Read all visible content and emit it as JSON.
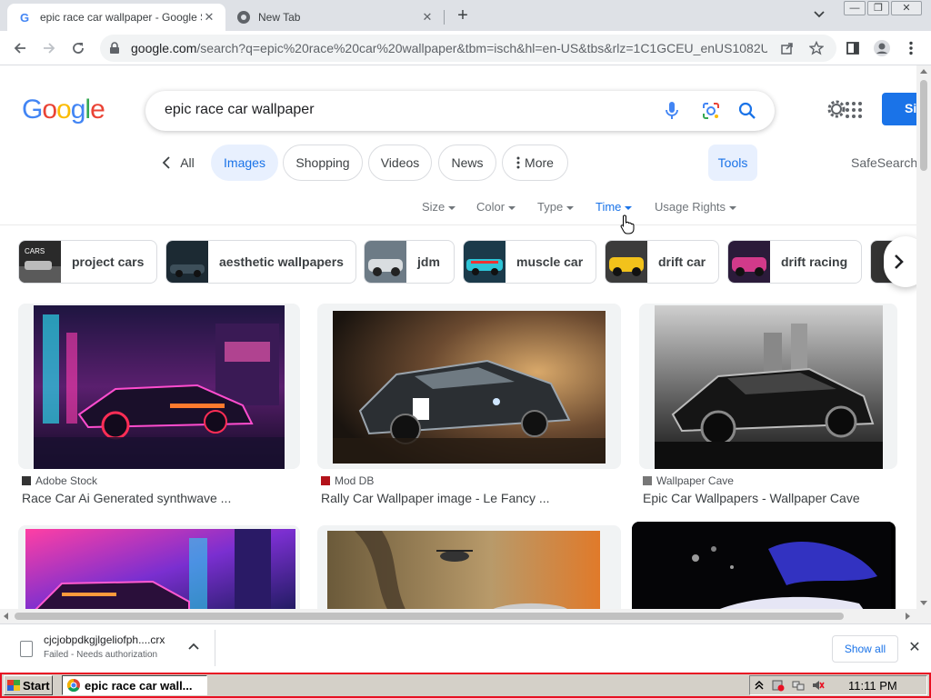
{
  "browser": {
    "tabs": [
      {
        "title": "epic race car wallpaper - Google Se",
        "active": true
      },
      {
        "title": "New Tab",
        "active": false
      }
    ],
    "url_host": "google.com",
    "url_rest": "/search?q=epic%20race%20car%20wallpaper&tbm=isch&hl=en-US&tbs&rlz=1C1GCEU_enUS1082U..."
  },
  "search": {
    "query": "epic race car wallpaper",
    "signin_label": "Si"
  },
  "filters": {
    "back_label": "All",
    "chips": [
      "Images",
      "Shopping",
      "Videos",
      "News",
      "More"
    ],
    "tools_label": "Tools",
    "safesearch_label": "SafeSearch"
  },
  "tools": [
    "Size",
    "Color",
    "Type",
    "Time",
    "Usage Rights"
  ],
  "related": [
    "project cars",
    "aesthetic wallpapers",
    "jdm",
    "muscle car",
    "drift car",
    "drift racing"
  ],
  "related_thumb_text": "CARS",
  "results": [
    {
      "source": "Adobe Stock",
      "title": "Race Car Ai Generated synthwave ..."
    },
    {
      "source": "Mod DB",
      "title": "Rally Car Wallpaper image - Le Fancy ..."
    },
    {
      "source": "Wallpaper Cave",
      "title": "Epic Car Wallpapers - Wallpaper Cave"
    }
  ],
  "download": {
    "filename": "cjcjobpdkgjlgeliofph....crx",
    "status": "Failed - Needs authorization",
    "show_all": "Show all"
  },
  "taskbar": {
    "start": "Start",
    "task": "epic race car wall...",
    "time": "11:11 PM"
  },
  "colors": {
    "accent": "#1a73e8",
    "chip_selected_bg": "#e8f0fe",
    "taskbar_border": "#e81123"
  }
}
